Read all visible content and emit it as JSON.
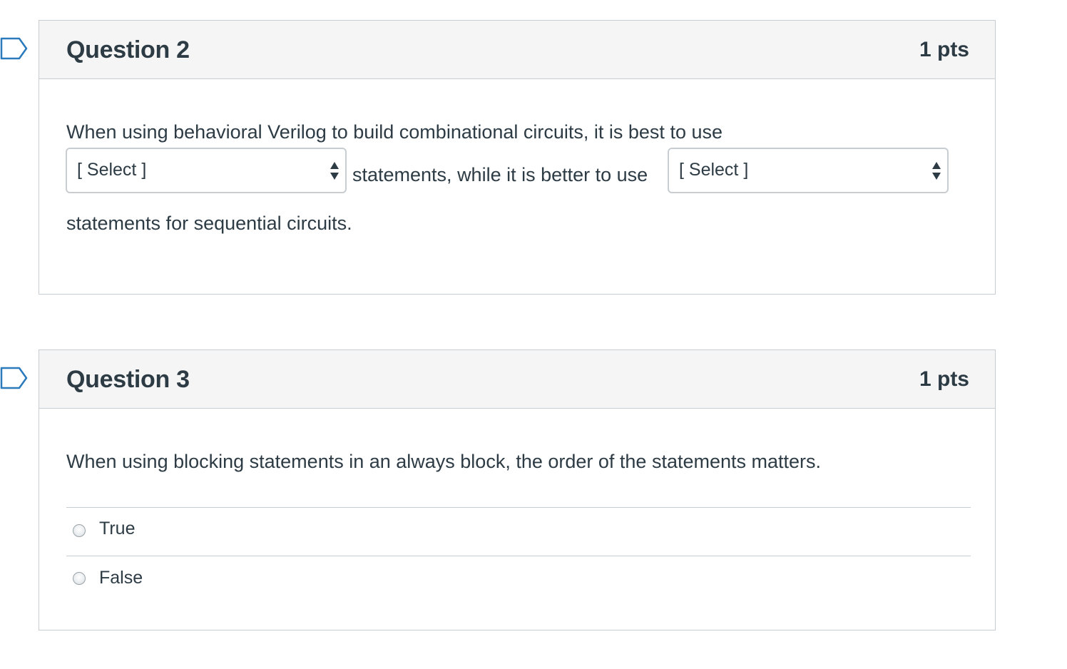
{
  "q2": {
    "title": "Question 2",
    "points": "1 pts",
    "text_part1": "When using behavioral Verilog to build  combinational circuits, it is best to use",
    "select1_value": "[ Select ]",
    "text_part2": "statements, while it is better to use",
    "select2_value": "[ Select ]",
    "text_part3": "statements for sequential circuits."
  },
  "q3": {
    "title": "Question 3",
    "points": "1 pts",
    "text": "When using blocking statements in an always block, the order of the statements matters.",
    "answers": [
      {
        "label": "True"
      },
      {
        "label": "False"
      }
    ]
  },
  "icons": {
    "flag": "flag-question-icon",
    "select_arrows": "up-down-arrows-icon",
    "radio": "radio-button-icon"
  },
  "colors": {
    "text": "#2d3b45",
    "border": "#c7cdd1",
    "header_bg": "#f5f5f5",
    "flag": "#2b7abc"
  }
}
